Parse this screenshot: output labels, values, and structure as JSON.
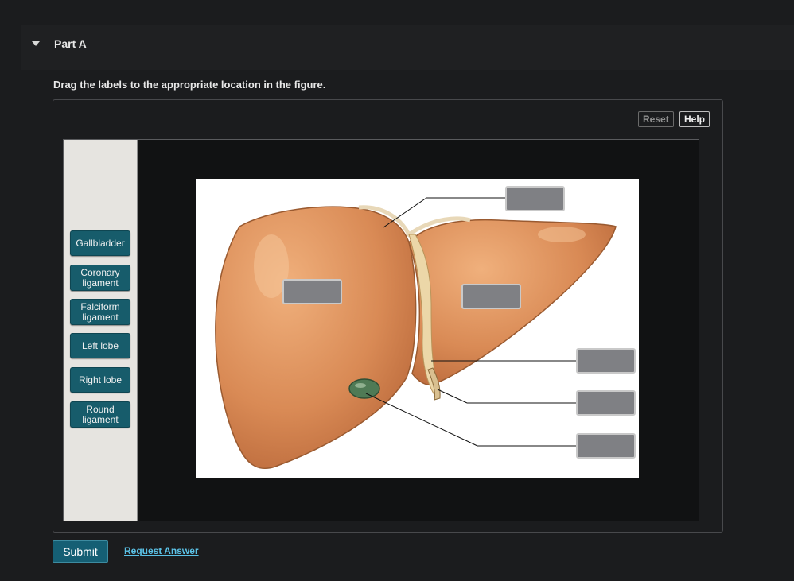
{
  "part": {
    "title": "Part A"
  },
  "instructions": "Drag the labels to the appropriate location in the figure.",
  "toolbar": {
    "reset_label": "Reset",
    "help_label": "Help"
  },
  "labels": [
    {
      "line1": "Gallbladder",
      "line2": ""
    },
    {
      "line1": "Coronary",
      "line2": "ligament"
    },
    {
      "line1": "Falciform",
      "line2": "ligament"
    },
    {
      "line1": "Left lobe",
      "line2": ""
    },
    {
      "line1": "Right lobe",
      "line2": ""
    },
    {
      "line1": "Round",
      "line2": "ligament"
    }
  ],
  "colors": {
    "accent": "#175c6b",
    "link": "#5bc2e7",
    "liver": "#d98a55",
    "gallbladder": "#4f7a55"
  },
  "actions": {
    "submit_label": "Submit",
    "request_label": "Request Answer"
  }
}
